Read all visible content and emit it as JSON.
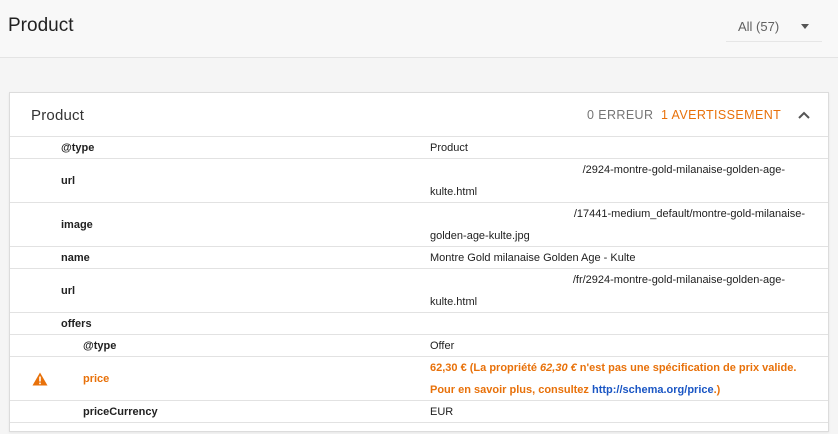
{
  "header": {
    "title": "Product",
    "filter_label": "All (57)"
  },
  "card": {
    "title": "Product",
    "errors": "0 ERREUR",
    "warnings": "1 AVERTISSEMENT"
  },
  "rows": [
    {
      "key": "@type",
      "value": "Product"
    },
    {
      "key": "url",
      "value_line1": "/2924-montre-gold-milanaise-golden-age-",
      "value_line2": "kulte.html"
    },
    {
      "key": "image",
      "value_line1": "/17441-medium_default/montre-gold-milanaise-",
      "value_line2": "golden-age-kulte.jpg"
    },
    {
      "key": "name",
      "value": "Montre Gold milanaise Golden Age - Kulte"
    },
    {
      "key": "url",
      "value_line1": "/fr/2924-montre-gold-milanaise-golden-age-",
      "value_line2": "kulte.html"
    },
    {
      "key": "offers",
      "value": ""
    },
    {
      "key": "@type",
      "value": "Offer"
    },
    {
      "key": "price",
      "warn_part1": "62,30 € (La propriété ",
      "warn_em": "62,30 €",
      "warn_part2": " n'est pas une spécification de prix valide.",
      "warn_line2_prefix": "Pour en savoir plus, consultez ",
      "warn_link": "http://schema.org/price",
      "warn_line2_suffix": ".)"
    },
    {
      "key": "priceCurrency",
      "value": "EUR"
    }
  ],
  "colors": {
    "warning": "#e8710a",
    "link": "#1a56c4"
  }
}
